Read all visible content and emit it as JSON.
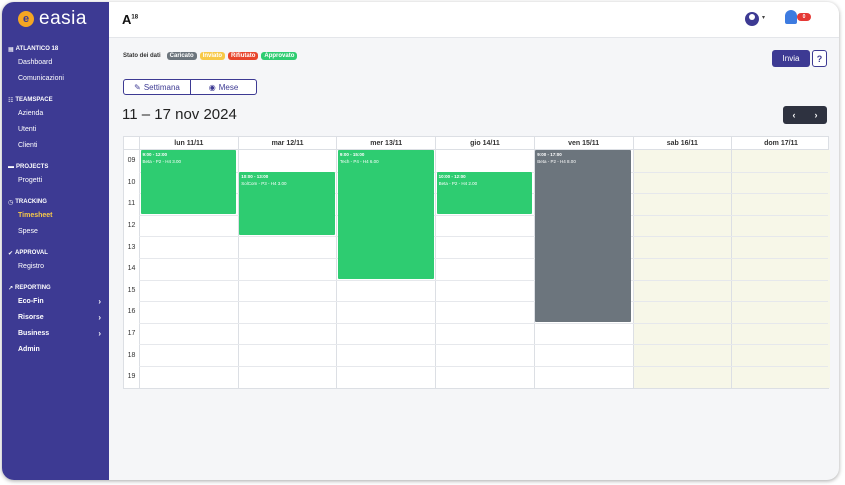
{
  "app": {
    "logo_text": "easia",
    "brand": "A",
    "brand_sup": "18",
    "notification_count": "0"
  },
  "sidebar": {
    "sections": [
      {
        "title": "ATLANTICO 18",
        "items": [
          {
            "label": "Dashboard"
          },
          {
            "label": "Comunicazioni"
          }
        ]
      },
      {
        "title": "TEAMSPACE",
        "items": [
          {
            "label": "Azienda"
          },
          {
            "label": "Utenti"
          },
          {
            "label": "Clienti"
          }
        ]
      },
      {
        "title": "PROJECTS",
        "items": [
          {
            "label": "Progetti"
          }
        ]
      },
      {
        "title": "TRACKING",
        "items": [
          {
            "label": "Timesheet",
            "active": true
          },
          {
            "label": "Spese"
          }
        ]
      },
      {
        "title": "APPROVAL",
        "items": [
          {
            "label": "Registro"
          }
        ]
      },
      {
        "title": "REPORTING",
        "items": [
          {
            "label": "Eco-Fin",
            "chevron": true
          },
          {
            "label": "Risorse",
            "chevron": true
          },
          {
            "label": "Business",
            "chevron": true
          },
          {
            "label": "Admin"
          }
        ]
      }
    ]
  },
  "legend": {
    "label": "Stato dei dati",
    "statuses": [
      {
        "label": "Caricato",
        "color": "#6c757d"
      },
      {
        "label": "Inviato",
        "color": "#f7c948"
      },
      {
        "label": "Rifiutato",
        "color": "#e8452c"
      },
      {
        "label": "Approvato",
        "color": "#2ecc71"
      }
    ]
  },
  "actions": {
    "submit": "Invia",
    "help": "?"
  },
  "views": {
    "week": "Settimana",
    "month": "Mese"
  },
  "range_title": "11 – 17 nov 2024",
  "nav": {
    "prev": "‹",
    "next": "›"
  },
  "calendar": {
    "days": [
      "lun 11/11",
      "mar 12/11",
      "mer 13/11",
      "gio 14/11",
      "ven 15/11",
      "sab 16/11",
      "dom 17/11"
    ],
    "weekend_days": [
      5,
      6
    ],
    "hours": [
      "09",
      "10",
      "11",
      "12",
      "13",
      "14",
      "15",
      "16",
      "17",
      "18",
      "19"
    ],
    "events": [
      {
        "day": 0,
        "start": 9,
        "end": 12,
        "time": "9:00 - 12:00",
        "text": "Beta - P2 - H4 3.00",
        "color": "#2ecc71"
      },
      {
        "day": 1,
        "start": 10,
        "end": 13,
        "time": "10:00 - 13:00",
        "text": "SolCom - P3 - H4 3.00",
        "color": "#2ecc71"
      },
      {
        "day": 2,
        "start": 9,
        "end": 15,
        "time": "9:00 - 15:00",
        "text": "Tech - P4 - H4 6.00",
        "color": "#2ecc71"
      },
      {
        "day": 3,
        "start": 10,
        "end": 12,
        "time": "10:00 - 12:00",
        "text": "Beta - P2 - H4 2.00",
        "color": "#2ecc71"
      },
      {
        "day": 4,
        "start": 9,
        "end": 17,
        "time": "9:00 - 17:00",
        "text": "Beta - P2 - H4 8.00",
        "color": "#6c757d"
      }
    ]
  }
}
